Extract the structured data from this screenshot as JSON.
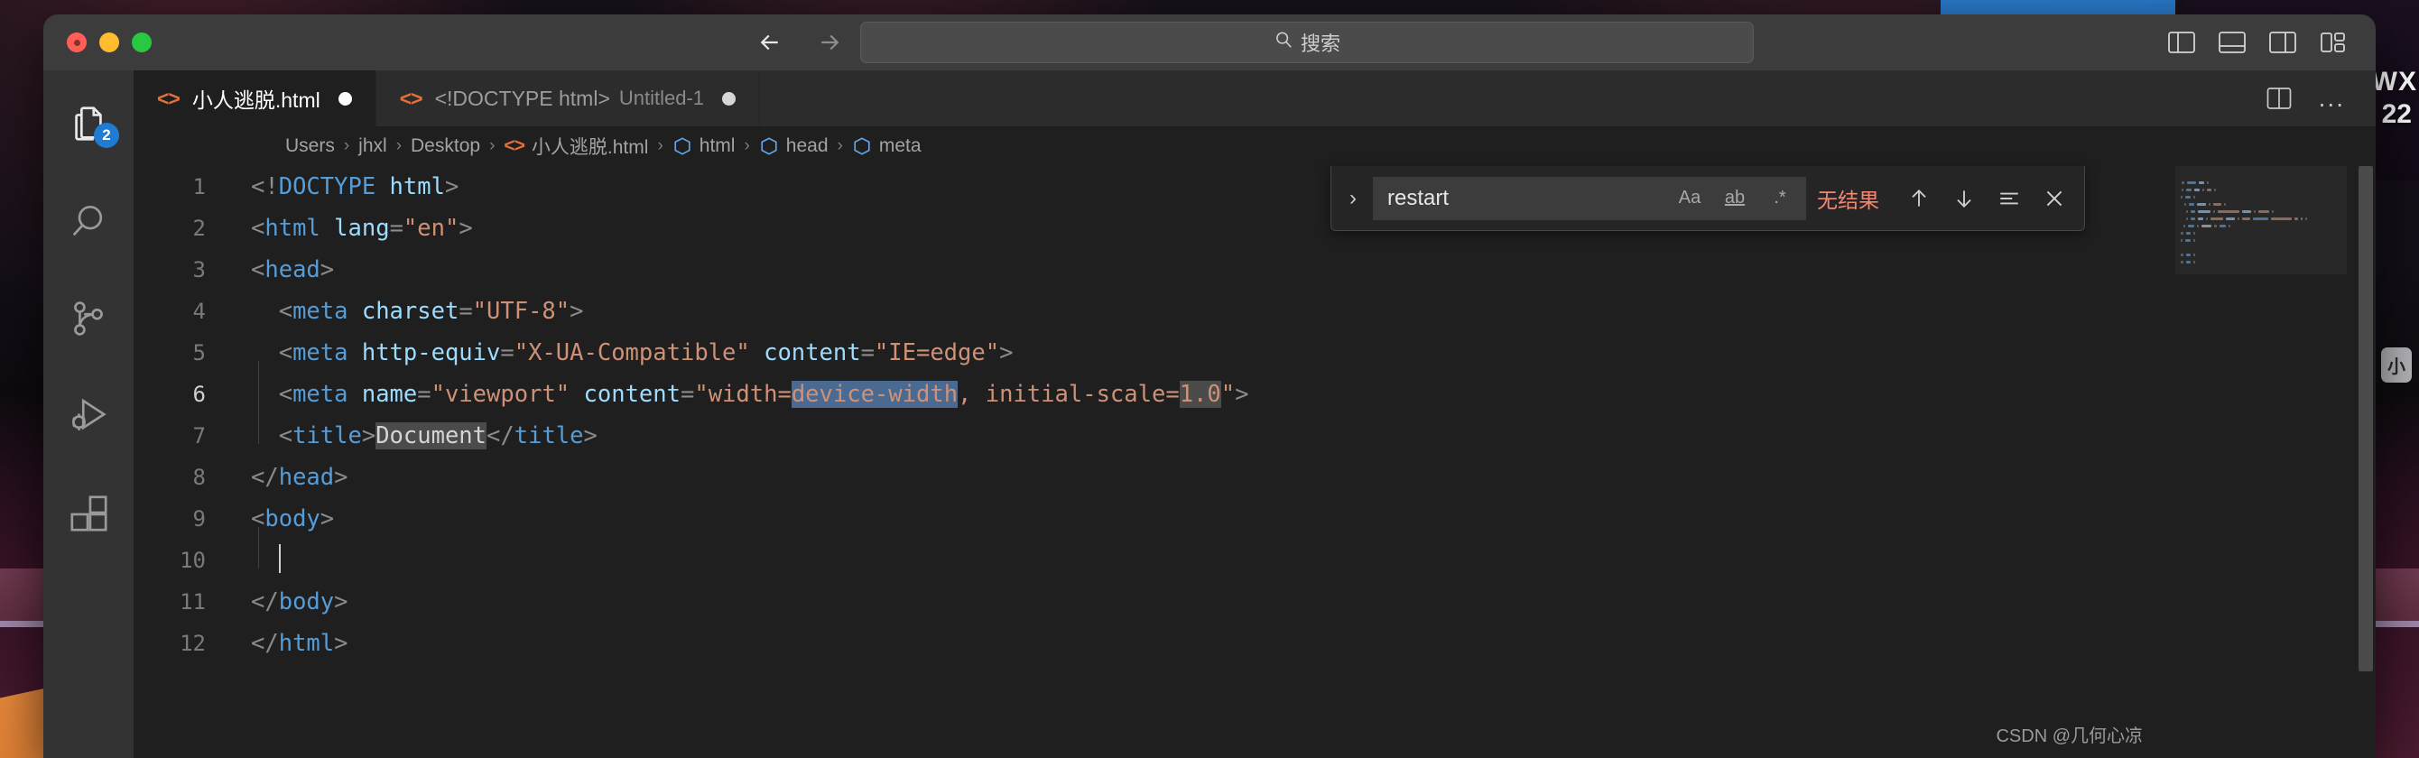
{
  "wallpaper": {
    "overlay_text_1": "WX",
    "overlay_text_2": "22",
    "chip_text": "小"
  },
  "title_bar": {
    "traffic_lights": [
      "close",
      "minimize",
      "maximize"
    ],
    "back_label": "←",
    "forward_label": "→",
    "search": {
      "icon": "search-icon",
      "placeholder": "搜索"
    },
    "layout_buttons": [
      {
        "name": "toggle-primary-sidebar",
        "label": "Toggle Primary Side Bar"
      },
      {
        "name": "toggle-panel",
        "label": "Toggle Panel"
      },
      {
        "name": "toggle-secondary-sidebar",
        "label": "Toggle Secondary Side Bar"
      },
      {
        "name": "customize-layout",
        "label": "Customize Layout"
      }
    ]
  },
  "activity_bar": {
    "items": [
      {
        "name": "explorer",
        "icon": "files-icon",
        "badge": "2",
        "active": true
      },
      {
        "name": "search",
        "icon": "search-icon",
        "badge": "",
        "active": false
      },
      {
        "name": "source-control",
        "icon": "source-control-icon",
        "badge": "",
        "active": false
      },
      {
        "name": "run-and-debug",
        "icon": "run-debug-icon",
        "badge": "",
        "active": false
      },
      {
        "name": "extensions",
        "icon": "extensions-icon",
        "badge": "",
        "active": false
      }
    ]
  },
  "tabs": [
    {
      "icon": "html-file-icon",
      "label": "小人逃脱.html",
      "description": "",
      "dirty": true,
      "active": true
    },
    {
      "icon": "html-file-icon",
      "label": "<!DOCTYPE html>",
      "description": "Untitled-1",
      "dirty": true,
      "active": false
    }
  ],
  "tab_actions": [
    {
      "name": "split-editor",
      "label": "Split Editor Right"
    },
    {
      "name": "more-actions",
      "label": "..."
    }
  ],
  "breadcrumb": {
    "items": [
      {
        "label": "Users",
        "icon": ""
      },
      {
        "label": "jhxl",
        "icon": ""
      },
      {
        "label": "Desktop",
        "icon": ""
      },
      {
        "label": "小人逃脱.html",
        "icon": "html-file-icon"
      },
      {
        "label": "html",
        "icon": "symbol-icon"
      },
      {
        "label": "head",
        "icon": "symbol-icon"
      },
      {
        "label": "meta",
        "icon": "symbol-icon"
      }
    ],
    "separator": "›"
  },
  "find_widget": {
    "toggle_icon": "chevron-right-icon",
    "query": "restart",
    "options": [
      {
        "name": "match-case",
        "label": "Aa"
      },
      {
        "name": "match-whole-word",
        "label": "ab"
      },
      {
        "name": "use-regex",
        "label": ".*"
      }
    ],
    "status": "无结果",
    "status_color": "#f48771",
    "actions": [
      {
        "name": "previous-match",
        "icon": "arrow-up-icon"
      },
      {
        "name": "next-match",
        "icon": "arrow-down-icon"
      },
      {
        "name": "find-in-selection",
        "icon": "selection-icon"
      },
      {
        "name": "close-find",
        "icon": "close-icon"
      }
    ]
  },
  "editor": {
    "language": "html",
    "cursor_line": 6,
    "lines": [
      {
        "number": "1",
        "tokens": [
          {
            "t": "<!",
            "c": "punct"
          },
          {
            "t": "DOCTYPE",
            "c": "tag"
          },
          {
            "t": " html",
            "c": "attr"
          },
          {
            "t": ">",
            "c": "punct"
          }
        ]
      },
      {
        "number": "2",
        "tokens": [
          {
            "t": "<",
            "c": "punct"
          },
          {
            "t": "html",
            "c": "tag"
          },
          {
            "t": " ",
            "c": "txt"
          },
          {
            "t": "lang",
            "c": "attr"
          },
          {
            "t": "=",
            "c": "punct"
          },
          {
            "t": "\"en\"",
            "c": "str"
          },
          {
            "t": ">",
            "c": "punct"
          }
        ]
      },
      {
        "number": "3",
        "tokens": [
          {
            "t": "<",
            "c": "punct"
          },
          {
            "t": "head",
            "c": "tag"
          },
          {
            "t": ">",
            "c": "punct"
          }
        ]
      },
      {
        "number": "4",
        "tokens": [
          {
            "t": "  <",
            "c": "punct"
          },
          {
            "t": "meta",
            "c": "tag"
          },
          {
            "t": " ",
            "c": "txt"
          },
          {
            "t": "charset",
            "c": "attr"
          },
          {
            "t": "=",
            "c": "punct"
          },
          {
            "t": "\"UTF-8\"",
            "c": "str"
          },
          {
            "t": ">",
            "c": "punct"
          }
        ]
      },
      {
        "number": "5",
        "tokens": [
          {
            "t": "  <",
            "c": "punct"
          },
          {
            "t": "meta",
            "c": "tag"
          },
          {
            "t": " ",
            "c": "txt"
          },
          {
            "t": "http-equiv",
            "c": "attr"
          },
          {
            "t": "=",
            "c": "punct"
          },
          {
            "t": "\"X-UA-Compatible\"",
            "c": "str"
          },
          {
            "t": " ",
            "c": "txt"
          },
          {
            "t": "content",
            "c": "attr"
          },
          {
            "t": "=",
            "c": "punct"
          },
          {
            "t": "\"IE=edge\"",
            "c": "str"
          },
          {
            "t": ">",
            "c": "punct"
          }
        ]
      },
      {
        "number": "6",
        "current": true,
        "tokens": [
          {
            "t": "  <",
            "c": "punct"
          },
          {
            "t": "meta",
            "c": "tag"
          },
          {
            "t": " ",
            "c": "txt"
          },
          {
            "t": "name",
            "c": "attr"
          },
          {
            "t": "=",
            "c": "punct"
          },
          {
            "t": "\"viewport\"",
            "c": "str"
          },
          {
            "t": " ",
            "c": "txt"
          },
          {
            "t": "content",
            "c": "attr"
          },
          {
            "t": "=",
            "c": "punct"
          },
          {
            "t": "\"width=",
            "c": "str"
          },
          {
            "t": "device-width",
            "c": "str",
            "hl": "selection"
          },
          {
            "t": ", initial-scale=",
            "c": "str"
          },
          {
            "t": "1.0",
            "c": "str",
            "hl": "word"
          },
          {
            "t": "\"",
            "c": "str"
          },
          {
            "t": ">",
            "c": "punct"
          }
        ]
      },
      {
        "number": "7",
        "tokens": [
          {
            "t": "  <",
            "c": "punct"
          },
          {
            "t": "title",
            "c": "tag"
          },
          {
            "t": ">",
            "c": "punct"
          },
          {
            "t": "Document",
            "c": "txt",
            "hl": "word"
          },
          {
            "t": "</",
            "c": "punct"
          },
          {
            "t": "title",
            "c": "tag"
          },
          {
            "t": ">",
            "c": "punct"
          }
        ]
      },
      {
        "number": "8",
        "tokens": [
          {
            "t": "</",
            "c": "punct"
          },
          {
            "t": "head",
            "c": "tag"
          },
          {
            "t": ">",
            "c": "punct"
          }
        ]
      },
      {
        "number": "9",
        "tokens": [
          {
            "t": "<",
            "c": "punct"
          },
          {
            "t": "body",
            "c": "tag"
          },
          {
            "t": ">",
            "c": "punct"
          }
        ]
      },
      {
        "number": "10",
        "caret": true,
        "tokens": [
          {
            "t": "  ",
            "c": "txt"
          }
        ]
      },
      {
        "number": "11",
        "tokens": [
          {
            "t": "</",
            "c": "punct"
          },
          {
            "t": "body",
            "c": "tag"
          },
          {
            "t": ">",
            "c": "punct"
          }
        ]
      },
      {
        "number": "12",
        "tokens": [
          {
            "t": "</",
            "c": "punct"
          },
          {
            "t": "html",
            "c": "tag"
          },
          {
            "t": ">",
            "c": "punct"
          }
        ]
      }
    ]
  },
  "colors": {
    "editor_background": "#1f1f1f",
    "tab_bar_background": "#2c2c2c",
    "title_bar_background": "#3c3c3c",
    "activity_bar_background": "#333333",
    "tag": "#569cd6",
    "attribute": "#9cdcfe",
    "string": "#ce9178",
    "text": "#d4d4d4",
    "punctuation": "#8b8b8b",
    "selection": "#4a6a92",
    "badge": "#1f7bd4",
    "error": "#f48771",
    "html_icon": "#e2703a"
  },
  "watermark": "CSDN @几何心凉"
}
